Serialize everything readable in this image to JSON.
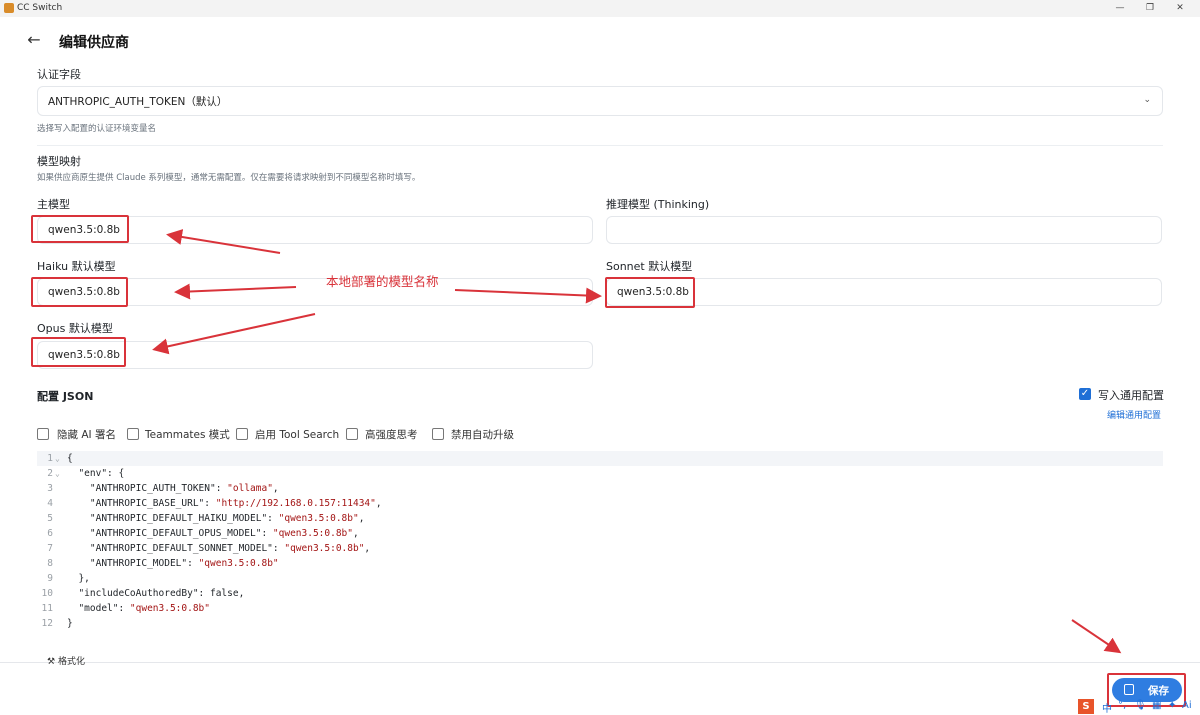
{
  "window": {
    "title": "CC Switch"
  },
  "header": {
    "title": "编辑供应商"
  },
  "auth_field": {
    "label": "认证字段",
    "selected": "ANTHROPIC_AUTH_TOKEN（默认）",
    "hint": "选择写入配置的认证环境变量名"
  },
  "model_mapping": {
    "title": "模型映射",
    "hint": "如果供应商原生提供 Claude 系列模型，通常无需配置。仅在需要将请求映射到不同模型名称时填写。",
    "main_model": {
      "label": "主模型",
      "value": "qwen3.5:0.8b"
    },
    "thinking_model": {
      "label": "推理模型 (Thinking)",
      "value": ""
    },
    "haiku_model": {
      "label": "Haiku 默认模型",
      "value": "qwen3.5:0.8b"
    },
    "sonnet_model": {
      "label": "Sonnet 默认模型",
      "value": "qwen3.5:0.8b"
    },
    "opus_model": {
      "label": "Opus 默认模型",
      "value": "qwen3.5:0.8b"
    }
  },
  "annotation": {
    "text": "本地部署的模型名称",
    "color": "#d9333a"
  },
  "config_json": {
    "title": "配置 JSON",
    "write_common": {
      "label": "写入通用配置",
      "checked": true
    },
    "edit_common_link": "编辑通用配置",
    "options": [
      {
        "label": "隐藏 AI 署名",
        "checked": false
      },
      {
        "label": "Teammates 模式",
        "checked": false
      },
      {
        "label": "启用 Tool Search",
        "checked": false
      },
      {
        "label": "高强度思考",
        "checked": false
      },
      {
        "label": "禁用自动升级",
        "checked": false
      }
    ],
    "code_lines": [
      {
        "n": "1",
        "fold": "⌄",
        "key": "{",
        "val": "",
        "tail": ""
      },
      {
        "n": "2",
        "fold": "⌄",
        "key": "  \"env\": {",
        "val": "",
        "tail": ""
      },
      {
        "n": "3",
        "fold": "",
        "key": "    \"ANTHROPIC_AUTH_TOKEN\": ",
        "val": "\"ollama\"",
        "tail": ","
      },
      {
        "n": "4",
        "fold": "",
        "key": "    \"ANTHROPIC_BASE_URL\": ",
        "val": "\"http://192.168.0.157:11434\"",
        "tail": ","
      },
      {
        "n": "5",
        "fold": "",
        "key": "    \"ANTHROPIC_DEFAULT_HAIKU_MODEL\": ",
        "val": "\"qwen3.5:0.8b\"",
        "tail": ","
      },
      {
        "n": "6",
        "fold": "",
        "key": "    \"ANTHROPIC_DEFAULT_OPUS_MODEL\": ",
        "val": "\"qwen3.5:0.8b\"",
        "tail": ","
      },
      {
        "n": "7",
        "fold": "",
        "key": "    \"ANTHROPIC_DEFAULT_SONNET_MODEL\": ",
        "val": "\"qwen3.5:0.8b\"",
        "tail": ","
      },
      {
        "n": "8",
        "fold": "",
        "key": "    \"ANTHROPIC_MODEL\": ",
        "val": "\"qwen3.5:0.8b\"",
        "tail": ""
      },
      {
        "n": "9",
        "fold": "",
        "key": "  },",
        "val": "",
        "tail": ""
      },
      {
        "n": "10",
        "fold": "",
        "key": "  \"includeCoAuthoredBy\": false,",
        "val": "",
        "tail": ""
      },
      {
        "n": "11",
        "fold": "",
        "key": "  \"model\": ",
        "val": "\"qwen3.5:0.8b\"",
        "tail": ""
      },
      {
        "n": "12",
        "fold": "",
        "key": "}",
        "val": "",
        "tail": ""
      }
    ],
    "format_label": "格式化"
  },
  "footer": {
    "save_label": "保存"
  },
  "tray": {
    "ime": "中",
    "items": [
      "°,",
      "🎙",
      "▦",
      "✦",
      "Ai"
    ]
  }
}
